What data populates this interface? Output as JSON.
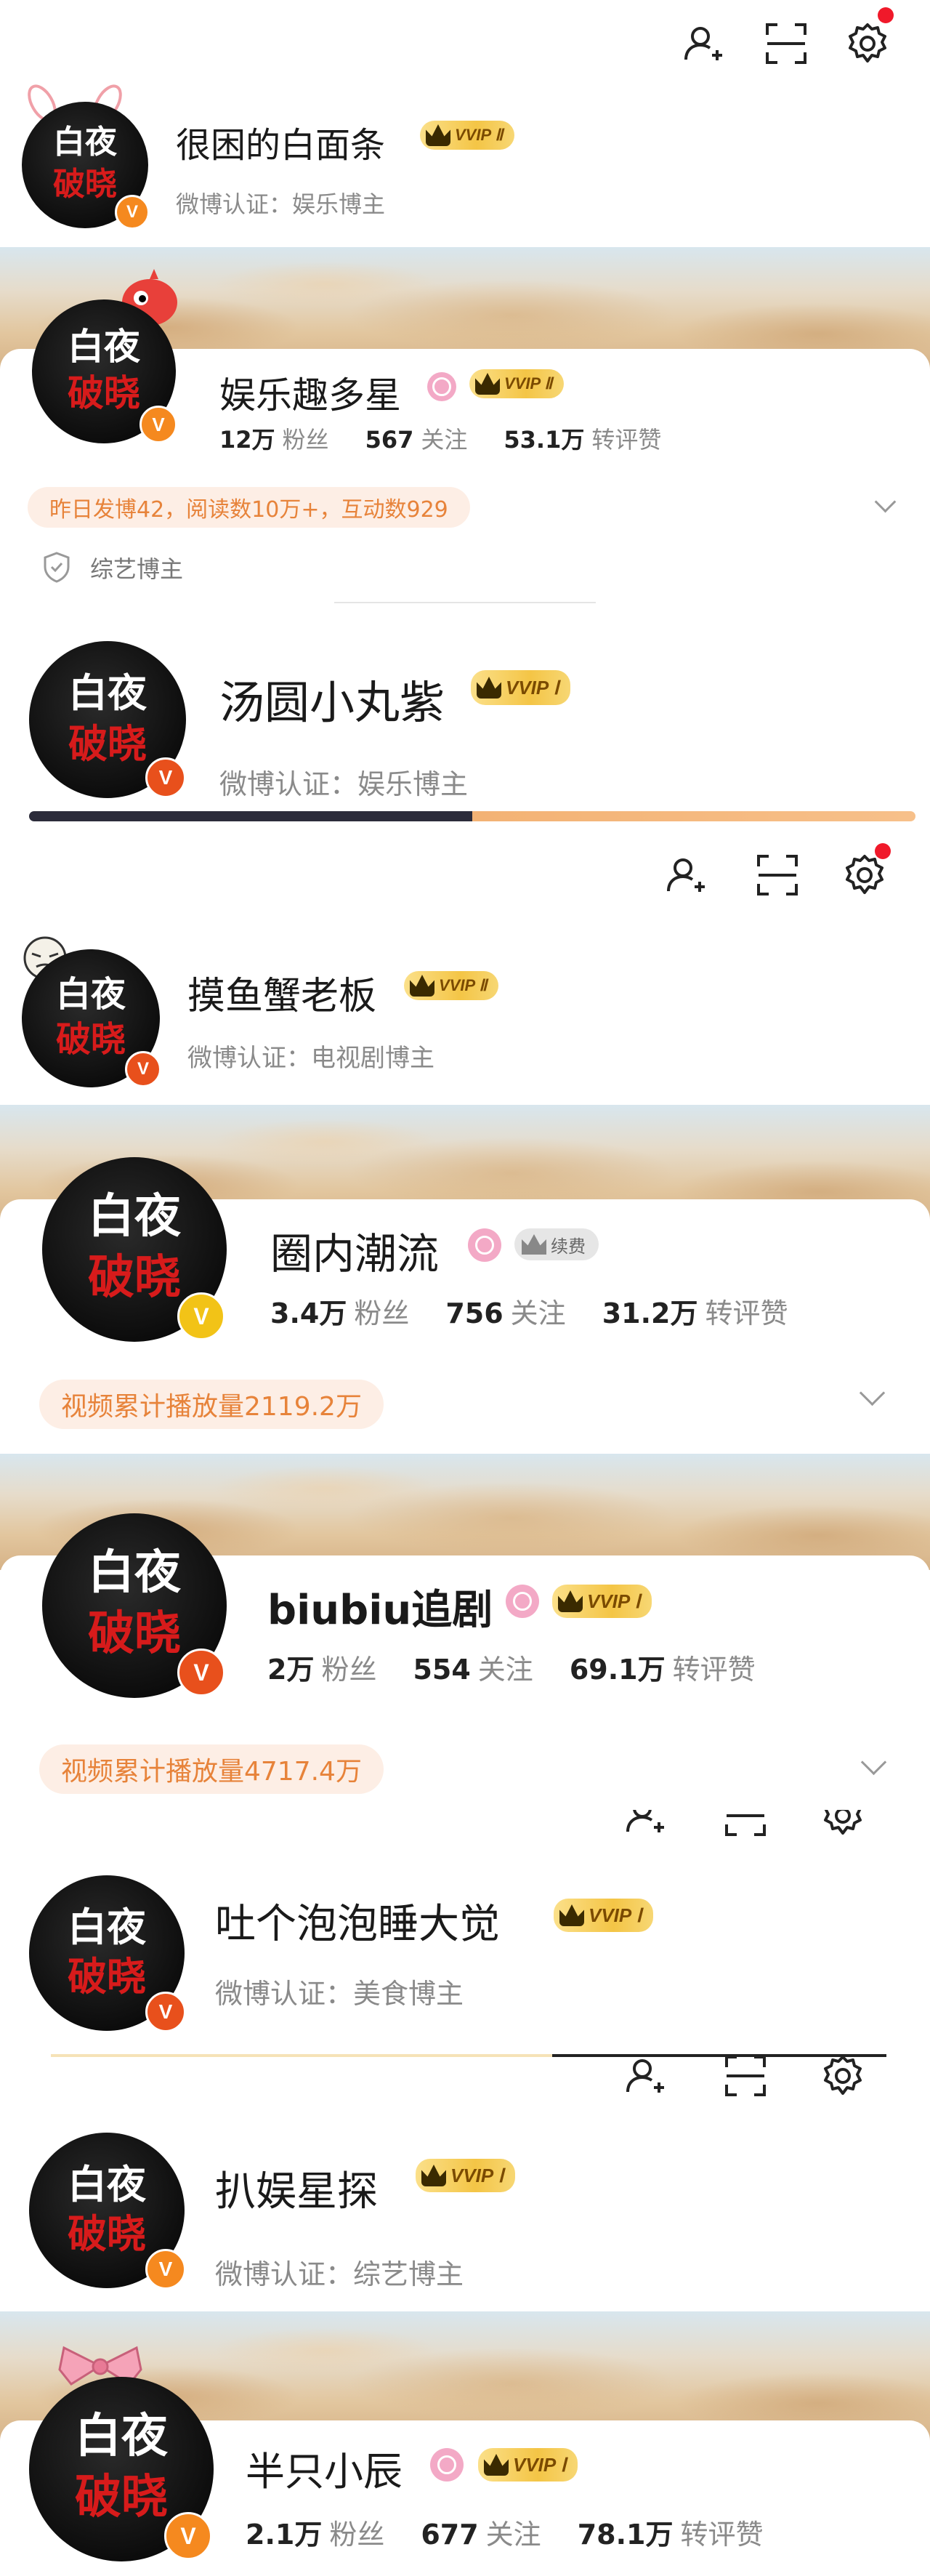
{
  "colors": {
    "accent_orange": "#f5891f",
    "pill_bg": "#fdeee5",
    "pill_text": "#e7833a",
    "vip_gold": "#f4c546",
    "red_dot": "#f0192a"
  },
  "avatar": {
    "line1": "白夜",
    "line2": "破晓"
  },
  "verified_badge": "V",
  "icons": [
    "add-friend-icon",
    "scan-icon",
    "settings-icon"
  ],
  "s1": {
    "name": "很困的白面条",
    "vip": "VVIP Ⅱ",
    "verify": "微博认证：娱乐博主"
  },
  "s2": {
    "name": "娱乐趣多星",
    "vip": "VVIP Ⅱ",
    "stats": [
      {
        "num": "12万",
        "label": "粉丝"
      },
      {
        "num": "567",
        "label": "关注"
      },
      {
        "num": "53.1万",
        "label": "转评赞"
      }
    ],
    "pill": "昨日发博42，阅读数10万+，互动数929",
    "tag": "综艺博主"
  },
  "s3": {
    "name": "汤圆小丸紫",
    "vip": "VVIP Ⅰ",
    "verify": "微博认证：娱乐博主"
  },
  "s4": {
    "name": "摸鱼蟹老板",
    "vip": "VVIP Ⅱ",
    "verify": "微博认证：电视剧博主"
  },
  "s5": {
    "name": "圈内潮流",
    "renew": "续费",
    "stats": [
      {
        "num": "3.4万",
        "label": "粉丝"
      },
      {
        "num": "756",
        "label": "关注"
      },
      {
        "num": "31.2万",
        "label": "转评赞"
      }
    ],
    "pill": "视频累计播放量2119.2万"
  },
  "s6": {
    "name": "biubiu追剧",
    "vip": "VVIP Ⅰ",
    "stats": [
      {
        "num": "2万",
        "label": "粉丝"
      },
      {
        "num": "554",
        "label": "关注"
      },
      {
        "num": "69.1万",
        "label": "转评赞"
      }
    ],
    "pill": "视频累计播放量4717.4万"
  },
  "s7": {
    "name": "吐个泡泡睡大觉",
    "vip": "VVIP Ⅰ",
    "verify": "微博认证：美食博主"
  },
  "s8": {
    "name": "扒娱星探",
    "vip": "VVIP Ⅰ",
    "verify": "微博认证：综艺博主"
  },
  "s9": {
    "name": "半只小辰",
    "vip": "VVIP Ⅰ",
    "stats": [
      {
        "num": "2.1万",
        "label": "粉丝"
      },
      {
        "num": "677",
        "label": "关注"
      },
      {
        "num": "78.1万",
        "label": "转评赞"
      }
    ]
  }
}
